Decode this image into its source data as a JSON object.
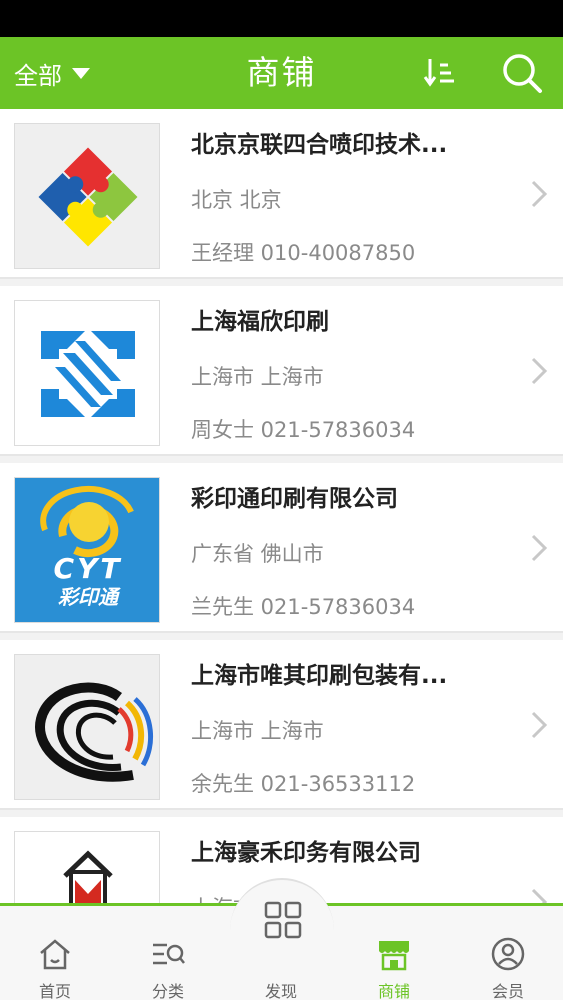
{
  "header": {
    "filter_label": "全部",
    "title": "商铺",
    "sort_icon": "sort-icon",
    "search_icon": "search-icon"
  },
  "shops": [
    {
      "name": "北京京联四合喷印技术...",
      "location": "北京 北京",
      "contact": "王经理 010-40087850"
    },
    {
      "name": "上海福欣印刷",
      "location": "上海市 上海市",
      "contact": "周女士 021-57836034"
    },
    {
      "name": "彩印通印刷有限公司",
      "location": "广东省 佛山市",
      "contact": "兰先生 021-57836034",
      "logo_text": "CYT",
      "logo_subtext": "彩印通"
    },
    {
      "name": "上海市唯其印刷包装有...",
      "location": "上海市 上海市",
      "contact": "余先生 021-36533112"
    },
    {
      "name": "上海豪禾印务有限公司",
      "location": "上海市 上海市",
      "contact": ""
    }
  ],
  "tabs": [
    {
      "label": "首页",
      "icon": "home-icon"
    },
    {
      "label": "分类",
      "icon": "category-icon"
    },
    {
      "label": "发现",
      "icon": "discover-icon"
    },
    {
      "label": "商铺",
      "icon": "shop-icon",
      "active": true
    },
    {
      "label": "会员",
      "icon": "member-icon"
    }
  ],
  "colors": {
    "accent": "#6cc426",
    "text": "#222222",
    "muted": "#8a8a8a"
  }
}
